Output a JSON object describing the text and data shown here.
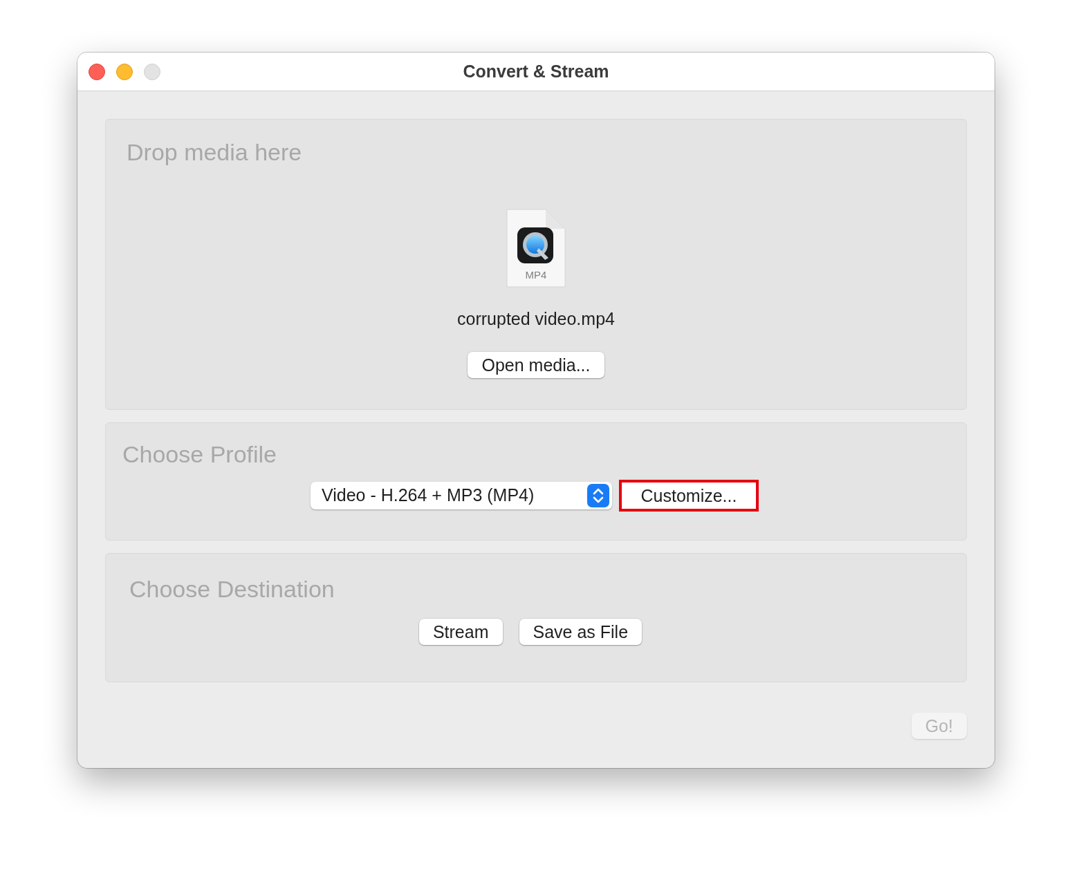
{
  "window": {
    "title": "Convert & Stream"
  },
  "drop_area": {
    "heading": "Drop media here",
    "file_badge": "MP4",
    "file_name": "corrupted video.mp4",
    "button": "Open media..."
  },
  "profile": {
    "heading": "Choose Profile",
    "selected_profile": "Video - H.264 + MP3 (MP4)",
    "customize_button": {
      "label": "Customize...",
      "highlighted": true
    }
  },
  "destination": {
    "heading": "Choose Destination",
    "buttons": [
      {
        "label": "Stream"
      },
      {
        "label": "Save as File"
      }
    ]
  },
  "go_button": {
    "label": "Go!",
    "disabled": true
  }
}
